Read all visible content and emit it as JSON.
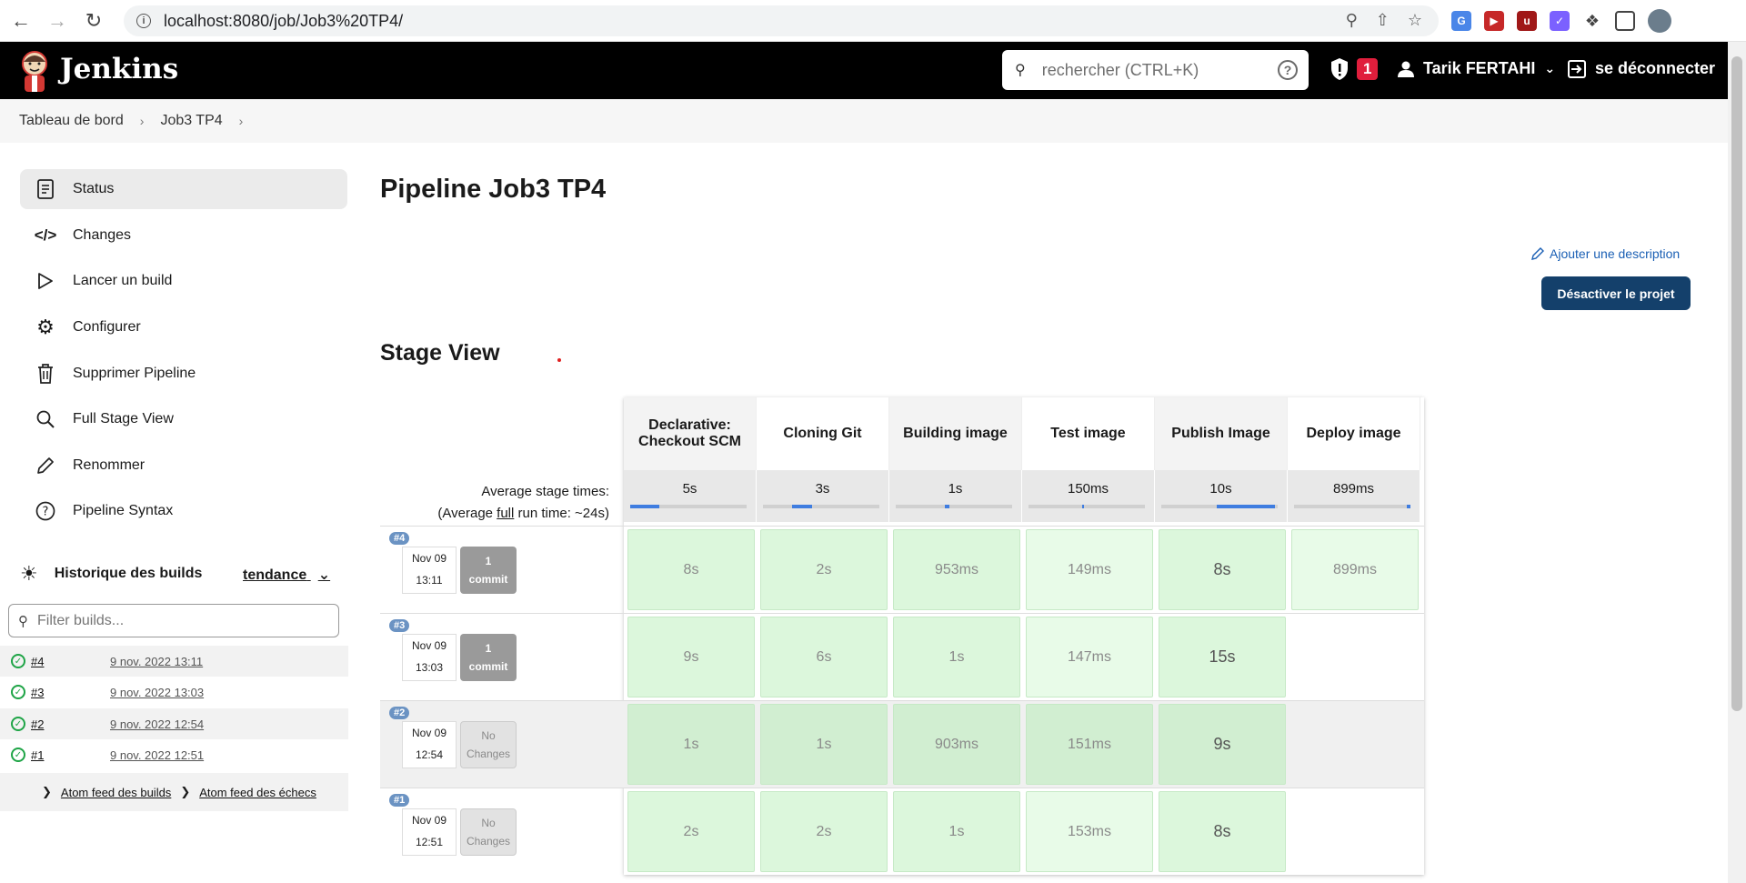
{
  "browser": {
    "url": "localhost:8080/job/Job3%20TP4/"
  },
  "header": {
    "brand": "Jenkins",
    "search_placeholder": "rechercher (CTRL+K)",
    "security_count": "1",
    "user_name": "Tarik FERTAHI",
    "logout_label": "se déconnecter"
  },
  "breadcrumbs": [
    "Tableau de bord",
    "Job3 TP4"
  ],
  "sidebar": {
    "items": [
      {
        "label": "Status",
        "icon": "status-icon"
      },
      {
        "label": "Changes",
        "icon": "code-icon"
      },
      {
        "label": "Lancer un build",
        "icon": "play-icon"
      },
      {
        "label": "Configurer",
        "icon": "gear-icon"
      },
      {
        "label": "Supprimer Pipeline",
        "icon": "trash-icon"
      },
      {
        "label": "Full Stage View",
        "icon": "search-icon"
      },
      {
        "label": "Renommer",
        "icon": "pencil-icon"
      },
      {
        "label": "Pipeline Syntax",
        "icon": "help-icon"
      }
    ],
    "history_title": "Historique des builds",
    "trend_label": "tendance",
    "filter_placeholder": "Filter builds...",
    "builds": [
      {
        "num": "#4",
        "date": "9 nov. 2022 13:11"
      },
      {
        "num": "#3",
        "date": "9 nov. 2022 13:03"
      },
      {
        "num": "#2",
        "date": "9 nov. 2022 12:54"
      },
      {
        "num": "#1",
        "date": "9 nov. 2022 12:51"
      }
    ],
    "feed_builds": "Atom feed des builds",
    "feed_failures": "Atom feed des échecs"
  },
  "main": {
    "title": "Pipeline Job3 TP4",
    "add_description": "Ajouter une description",
    "disable_button": "Désactiver le projet",
    "stage_view_title": "Stage View",
    "avg_label_1": "Average stage times:",
    "avg_label_2_prefix": "(Average ",
    "avg_label_2_link": "full",
    "avg_label_2_suffix": " run time: ~24s)"
  },
  "stages": {
    "headers": [
      "Declarative: Checkout SCM",
      "Cloning Git",
      "Building image",
      "Test image",
      "Publish Image",
      "Deploy image"
    ],
    "averages": [
      "5s",
      "3s",
      "1s",
      "150ms",
      "10s",
      "899ms"
    ],
    "avg_progress": [
      {
        "start": 0.0,
        "end": 0.25
      },
      {
        "start": 0.25,
        "end": 0.42
      },
      {
        "start": 0.42,
        "end": 0.46
      },
      {
        "start": 0.46,
        "end": 0.48
      },
      {
        "start": 0.48,
        "end": 0.98
      },
      {
        "start": 0.97,
        "end": 1.0
      }
    ]
  },
  "runs": [
    {
      "badge": "#4",
      "date": "Nov 09",
      "time": "13:11",
      "commit_top": "1",
      "commit_bottom": "commit",
      "has_commit": true,
      "cells": [
        "8s",
        "2s",
        "953ms",
        "149ms",
        "8s",
        "899ms"
      ]
    },
    {
      "badge": "#3",
      "date": "Nov 09",
      "time": "13:03",
      "commit_top": "1",
      "commit_bottom": "commit",
      "has_commit": true,
      "cells": [
        "9s",
        "6s",
        "1s",
        "147ms",
        "15s",
        ""
      ]
    },
    {
      "badge": "#2",
      "date": "Nov 09",
      "time": "12:54",
      "commit_top": "No",
      "commit_bottom": "Changes",
      "has_commit": false,
      "cells": [
        "1s",
        "1s",
        "903ms",
        "151ms",
        "9s",
        ""
      ]
    },
    {
      "badge": "#1",
      "date": "Nov 09",
      "time": "12:51",
      "commit_top": "No",
      "commit_bottom": "Changes",
      "has_commit": false,
      "cells": [
        "2s",
        "2s",
        "1s",
        "153ms",
        "8s",
        ""
      ]
    }
  ],
  "colors": {
    "header_bg": "#000000",
    "accent_button": "#14406b",
    "success_green": "#1ea446",
    "stage_cell": "#dcf7dc",
    "badge_red": "#e01e3c"
  }
}
